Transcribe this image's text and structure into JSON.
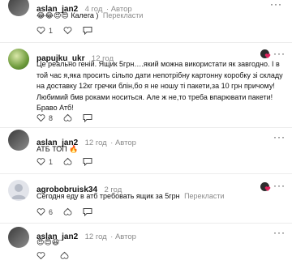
{
  "comments": [
    {
      "author": "aslan_jan2",
      "time": "4 год",
      "role": "Автор",
      "text_emoji": "😂😂😍😍",
      "text": "Калега )",
      "translate": "Перекласти",
      "likes": "1"
    },
    {
      "author": "papujku_ukr",
      "time": "12 год",
      "text": "Це реально геній. Ящик 5грн….який можна використати як завгодно. І в той час я,яка просить сільпо дати непотрібну картонну коробку зі складу на доставку 12кг гречки блін,бо я не ношу ті пакети,за 10 грн причому! Любимий бмв роками носиться. Але ж не,то треба впарювати пакети! Браво Атб!",
      "likes": "8"
    },
    {
      "author": "aslan_jan2",
      "time": "12 год",
      "role": "Автор",
      "text": "АТБ ТОП",
      "text_emoji": "🔥",
      "likes": "1"
    },
    {
      "author": "agrobobruisk34",
      "time": "2 год",
      "text": "Сегодня еду в атб требовать ящик за 5грн",
      "translate": "Перекласти",
      "likes": "6"
    },
    {
      "author": "aslan_jan2",
      "time": "12 год",
      "role": "Автор",
      "text_emoji": "😍😍😆"
    }
  ]
}
